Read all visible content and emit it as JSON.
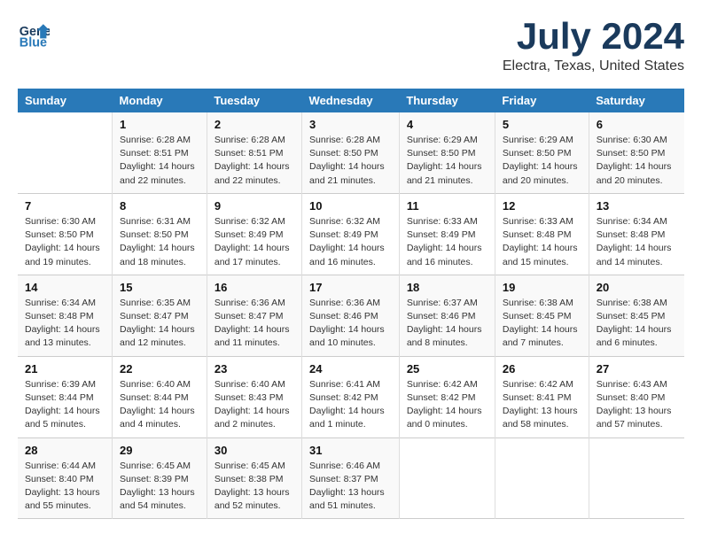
{
  "header": {
    "logo_line1": "General",
    "logo_line2": "Blue",
    "month_year": "July 2024",
    "location": "Electra, Texas, United States"
  },
  "days_of_week": [
    "Sunday",
    "Monday",
    "Tuesday",
    "Wednesday",
    "Thursday",
    "Friday",
    "Saturday"
  ],
  "weeks": [
    [
      {
        "day": "",
        "info": ""
      },
      {
        "day": "1",
        "info": "Sunrise: 6:28 AM\nSunset: 8:51 PM\nDaylight: 14 hours\nand 22 minutes."
      },
      {
        "day": "2",
        "info": "Sunrise: 6:28 AM\nSunset: 8:51 PM\nDaylight: 14 hours\nand 22 minutes."
      },
      {
        "day": "3",
        "info": "Sunrise: 6:28 AM\nSunset: 8:50 PM\nDaylight: 14 hours\nand 21 minutes."
      },
      {
        "day": "4",
        "info": "Sunrise: 6:29 AM\nSunset: 8:50 PM\nDaylight: 14 hours\nand 21 minutes."
      },
      {
        "day": "5",
        "info": "Sunrise: 6:29 AM\nSunset: 8:50 PM\nDaylight: 14 hours\nand 20 minutes."
      },
      {
        "day": "6",
        "info": "Sunrise: 6:30 AM\nSunset: 8:50 PM\nDaylight: 14 hours\nand 20 minutes."
      }
    ],
    [
      {
        "day": "7",
        "info": "Sunrise: 6:30 AM\nSunset: 8:50 PM\nDaylight: 14 hours\nand 19 minutes."
      },
      {
        "day": "8",
        "info": "Sunrise: 6:31 AM\nSunset: 8:50 PM\nDaylight: 14 hours\nand 18 minutes."
      },
      {
        "day": "9",
        "info": "Sunrise: 6:32 AM\nSunset: 8:49 PM\nDaylight: 14 hours\nand 17 minutes."
      },
      {
        "day": "10",
        "info": "Sunrise: 6:32 AM\nSunset: 8:49 PM\nDaylight: 14 hours\nand 16 minutes."
      },
      {
        "day": "11",
        "info": "Sunrise: 6:33 AM\nSunset: 8:49 PM\nDaylight: 14 hours\nand 16 minutes."
      },
      {
        "day": "12",
        "info": "Sunrise: 6:33 AM\nSunset: 8:48 PM\nDaylight: 14 hours\nand 15 minutes."
      },
      {
        "day": "13",
        "info": "Sunrise: 6:34 AM\nSunset: 8:48 PM\nDaylight: 14 hours\nand 14 minutes."
      }
    ],
    [
      {
        "day": "14",
        "info": "Sunrise: 6:34 AM\nSunset: 8:48 PM\nDaylight: 14 hours\nand 13 minutes."
      },
      {
        "day": "15",
        "info": "Sunrise: 6:35 AM\nSunset: 8:47 PM\nDaylight: 14 hours\nand 12 minutes."
      },
      {
        "day": "16",
        "info": "Sunrise: 6:36 AM\nSunset: 8:47 PM\nDaylight: 14 hours\nand 11 minutes."
      },
      {
        "day": "17",
        "info": "Sunrise: 6:36 AM\nSunset: 8:46 PM\nDaylight: 14 hours\nand 10 minutes."
      },
      {
        "day": "18",
        "info": "Sunrise: 6:37 AM\nSunset: 8:46 PM\nDaylight: 14 hours\nand 8 minutes."
      },
      {
        "day": "19",
        "info": "Sunrise: 6:38 AM\nSunset: 8:45 PM\nDaylight: 14 hours\nand 7 minutes."
      },
      {
        "day": "20",
        "info": "Sunrise: 6:38 AM\nSunset: 8:45 PM\nDaylight: 14 hours\nand 6 minutes."
      }
    ],
    [
      {
        "day": "21",
        "info": "Sunrise: 6:39 AM\nSunset: 8:44 PM\nDaylight: 14 hours\nand 5 minutes."
      },
      {
        "day": "22",
        "info": "Sunrise: 6:40 AM\nSunset: 8:44 PM\nDaylight: 14 hours\nand 4 minutes."
      },
      {
        "day": "23",
        "info": "Sunrise: 6:40 AM\nSunset: 8:43 PM\nDaylight: 14 hours\nand 2 minutes."
      },
      {
        "day": "24",
        "info": "Sunrise: 6:41 AM\nSunset: 8:42 PM\nDaylight: 14 hours\nand 1 minute."
      },
      {
        "day": "25",
        "info": "Sunrise: 6:42 AM\nSunset: 8:42 PM\nDaylight: 14 hours\nand 0 minutes."
      },
      {
        "day": "26",
        "info": "Sunrise: 6:42 AM\nSunset: 8:41 PM\nDaylight: 13 hours\nand 58 minutes."
      },
      {
        "day": "27",
        "info": "Sunrise: 6:43 AM\nSunset: 8:40 PM\nDaylight: 13 hours\nand 57 minutes."
      }
    ],
    [
      {
        "day": "28",
        "info": "Sunrise: 6:44 AM\nSunset: 8:40 PM\nDaylight: 13 hours\nand 55 minutes."
      },
      {
        "day": "29",
        "info": "Sunrise: 6:45 AM\nSunset: 8:39 PM\nDaylight: 13 hours\nand 54 minutes."
      },
      {
        "day": "30",
        "info": "Sunrise: 6:45 AM\nSunset: 8:38 PM\nDaylight: 13 hours\nand 52 minutes."
      },
      {
        "day": "31",
        "info": "Sunrise: 6:46 AM\nSunset: 8:37 PM\nDaylight: 13 hours\nand 51 minutes."
      },
      {
        "day": "",
        "info": ""
      },
      {
        "day": "",
        "info": ""
      },
      {
        "day": "",
        "info": ""
      }
    ]
  ]
}
